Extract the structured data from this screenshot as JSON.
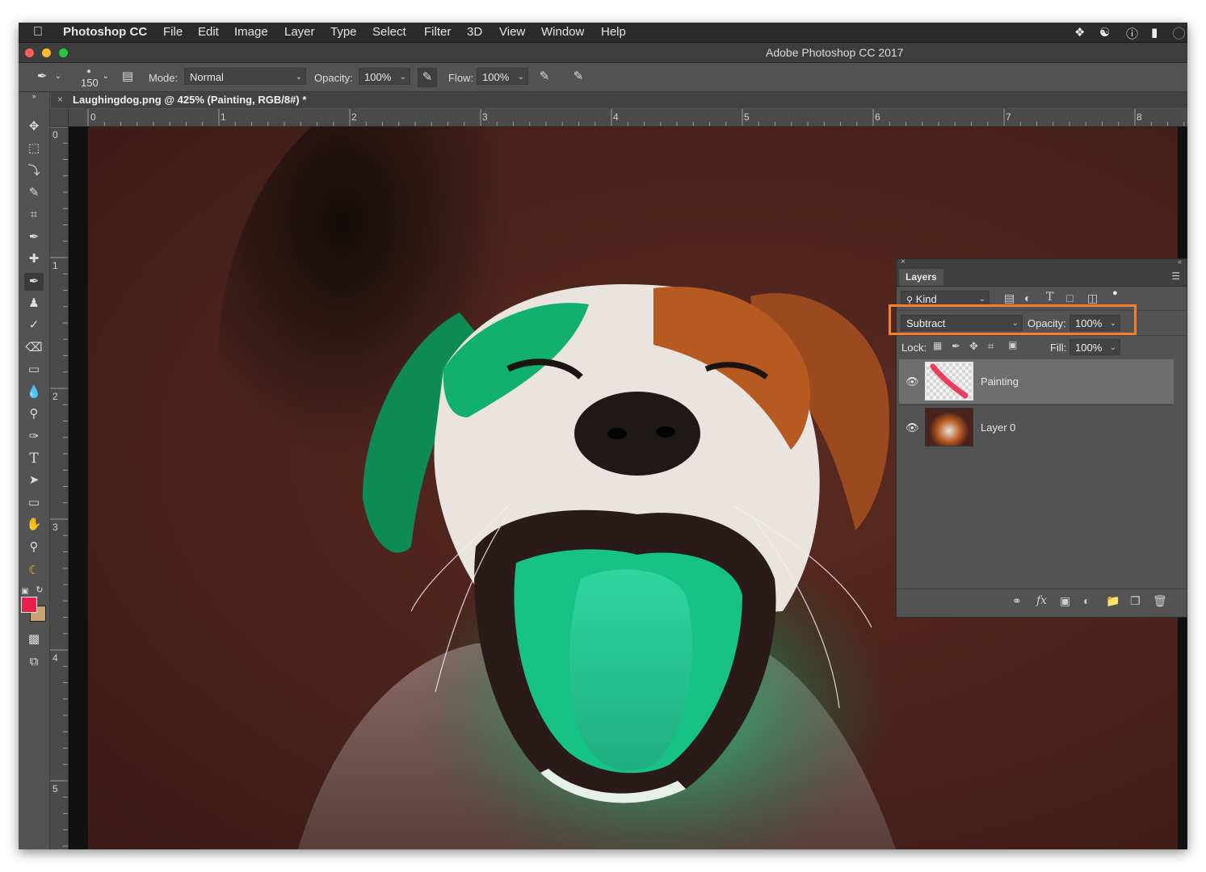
{
  "menubar": {
    "app_name": "Photoshop CC",
    "items": [
      "File",
      "Edit",
      "Image",
      "Layer",
      "Type",
      "Select",
      "Filter",
      "3D",
      "View",
      "Window",
      "Help"
    ]
  },
  "titlebar": {
    "title": "Adobe Photoshop CC 2017"
  },
  "options": {
    "brush_size": "150",
    "mode_label": "Mode:",
    "mode_value": "Normal",
    "opacity_label": "Opacity:",
    "opacity_value": "100%",
    "flow_label": "Flow:",
    "flow_value": "100%"
  },
  "document": {
    "tab_title": "Laughingdog.png @ 425% (Painting, RGB/8#) *"
  },
  "rulers": {
    "top": [
      "0",
      "1",
      "2",
      "3",
      "4",
      "5",
      "6",
      "7",
      "8"
    ],
    "left": [
      "0",
      "1",
      "2",
      "3",
      "4",
      "5"
    ]
  },
  "colors": {
    "foreground": "#e8204a",
    "background": "#c9a173",
    "highlight": "#f5822a"
  },
  "layers_panel": {
    "tab": "Layers",
    "filter_kind": "Kind",
    "blend_mode": "Subtract",
    "opacity_label": "Opacity:",
    "opacity_value": "100%",
    "lock_label": "Lock:",
    "fill_label": "Fill:",
    "fill_value": "100%",
    "layers": [
      {
        "name": "Painting",
        "selected": true,
        "visible": true
      },
      {
        "name": "Layer 0",
        "selected": false,
        "visible": true
      }
    ]
  }
}
